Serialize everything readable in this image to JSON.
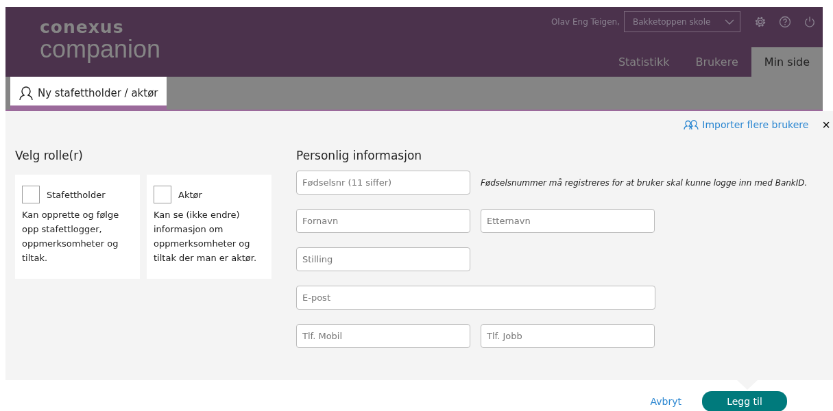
{
  "header": {
    "logo_top": "conexus",
    "logo_bottom": "companion",
    "user": "Olav Eng Teigen,",
    "school": "Bakketoppen skole"
  },
  "nav": [
    {
      "label": "Statistikk",
      "selected": false
    },
    {
      "label": "Brukere",
      "selected": false
    },
    {
      "label": "Min side",
      "selected": true
    }
  ],
  "subtab": {
    "label": "Ny stafettholder / aktør",
    "selected": true
  },
  "import_link": "Importer flere brukere",
  "close": "×",
  "roles": {
    "title": "Velg rolle(r)",
    "items": [
      {
        "label": "Stafettholder",
        "checked": false,
        "description": "Kan opprette og følge opp stafettlogger, oppmerksomheter og tiltak."
      },
      {
        "label": "Aktør",
        "checked": false,
        "description": "Kan se (ikke endre) informasjon om oppmerksomheter og tiltak der man er aktør."
      }
    ]
  },
  "personal": {
    "title": "Personlig informasjon",
    "note": "Fødselsnummer må registreres for at bruker skal kunne logge inn med BankID.",
    "rows": [
      {
        "fields": [
          {
            "placeholder": "Fødselsnr (11 siffer)",
            "kind": "half"
          }
        ]
      },
      {
        "fields": [
          {
            "placeholder": "Fornavn",
            "kind": "half"
          },
          {
            "placeholder": "Etternavn",
            "kind": "half"
          }
        ]
      },
      {
        "fields": [
          {
            "placeholder": "Stilling",
            "kind": "half"
          }
        ]
      },
      {
        "fields": [
          {
            "placeholder": "E-post",
            "kind": "full"
          }
        ]
      },
      {
        "fields": [
          {
            "placeholder": "Tlf. Mobil",
            "kind": "half"
          },
          {
            "placeholder": "Tlf. Jobb",
            "kind": "half"
          }
        ]
      }
    ]
  },
  "actions": {
    "cancel": "Avbryt",
    "submit": "Legg til"
  }
}
